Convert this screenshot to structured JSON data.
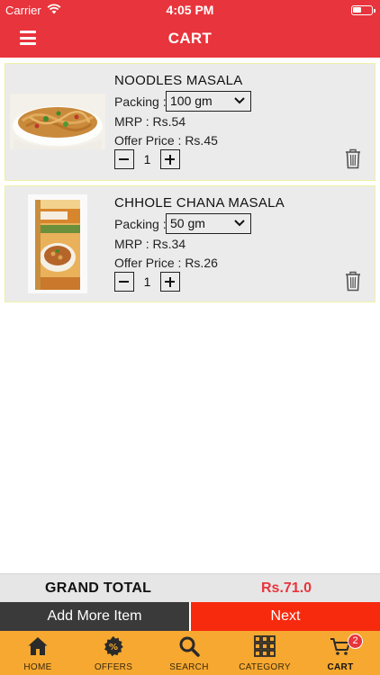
{
  "status_bar": {
    "carrier": "Carrier",
    "time": "4:05 PM"
  },
  "header": {
    "title": "CART",
    "menu_icon": "hamburger-menu-icon"
  },
  "cart": {
    "items": [
      {
        "name": "NOODLES MASALA",
        "packing_label": "Packing :",
        "packing_value": "100 gm",
        "mrp": "MRP : Rs.54",
        "offer_price": "Offer Price : Rs.45",
        "quantity": "1"
      },
      {
        "name": "CHHOLE CHANA MASALA",
        "packing_label": "Packing :",
        "packing_value": "50 gm",
        "mrp": "MRP : Rs.34",
        "offer_price": "Offer Price : Rs.26",
        "quantity": "1"
      }
    ]
  },
  "totals": {
    "label": "GRAND TOTAL",
    "amount": "Rs.71.0"
  },
  "actions": {
    "add_more": "Add More Item",
    "next": "Next"
  },
  "tabbar": {
    "tabs": [
      {
        "label": "HOME",
        "icon": "home-icon"
      },
      {
        "label": "OFFERS",
        "icon": "offer-badge-icon"
      },
      {
        "label": "SEARCH",
        "icon": "search-icon"
      },
      {
        "label": "CATEGORY",
        "icon": "grid-icon"
      },
      {
        "label": "CART",
        "icon": "cart-icon",
        "badge": "2"
      }
    ]
  },
  "colors": {
    "primary_red": "#e8343c",
    "next_button": "#f72a0e",
    "tabbar": "#f6a830",
    "add_button": "#3a3a3a"
  }
}
